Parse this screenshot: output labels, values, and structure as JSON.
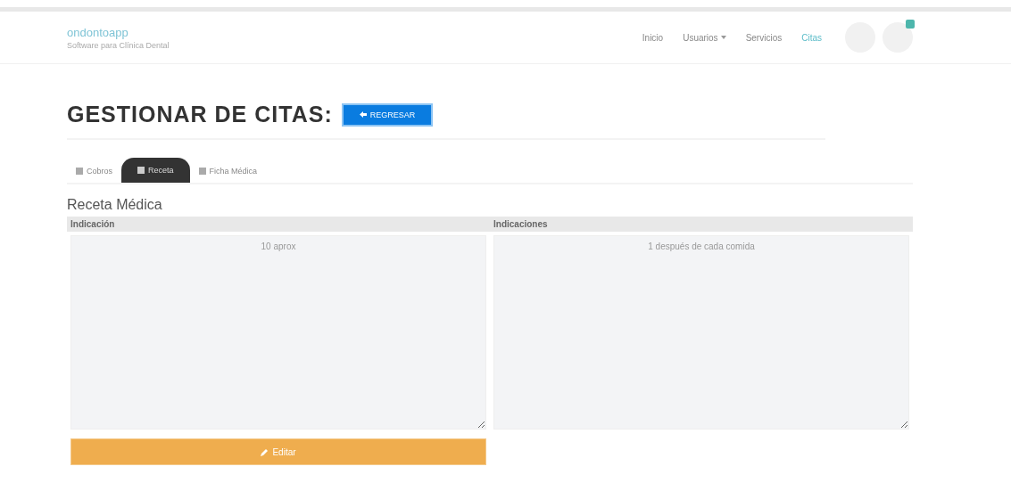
{
  "header": {
    "logo": "ondontoapp",
    "tagline": "Software para Clínica Dental",
    "nav": [
      {
        "label": "Inicio",
        "selected": false,
        "dropdown": false
      },
      {
        "label": "Usuarios",
        "selected": false,
        "dropdown": true
      },
      {
        "label": "Servicios",
        "selected": false,
        "dropdown": false
      },
      {
        "label": "Citas",
        "selected": true,
        "dropdown": false
      }
    ],
    "notification": true
  },
  "page": {
    "title": "GESTIONAR DE CITAS:",
    "back_button": "REGRESAR"
  },
  "tabs": [
    {
      "label": "Cobros",
      "selected": false
    },
    {
      "label": "Receta",
      "selected": true
    },
    {
      "label": "Ficha Médica",
      "selected": false
    }
  ],
  "prescription": {
    "title": "Receta Médica",
    "fields": [
      {
        "label": "Indicación",
        "value": "10 aprox"
      },
      {
        "label": "Indicaciones",
        "value": "1 después de cada comida"
      }
    ],
    "button": "Editar"
  }
}
